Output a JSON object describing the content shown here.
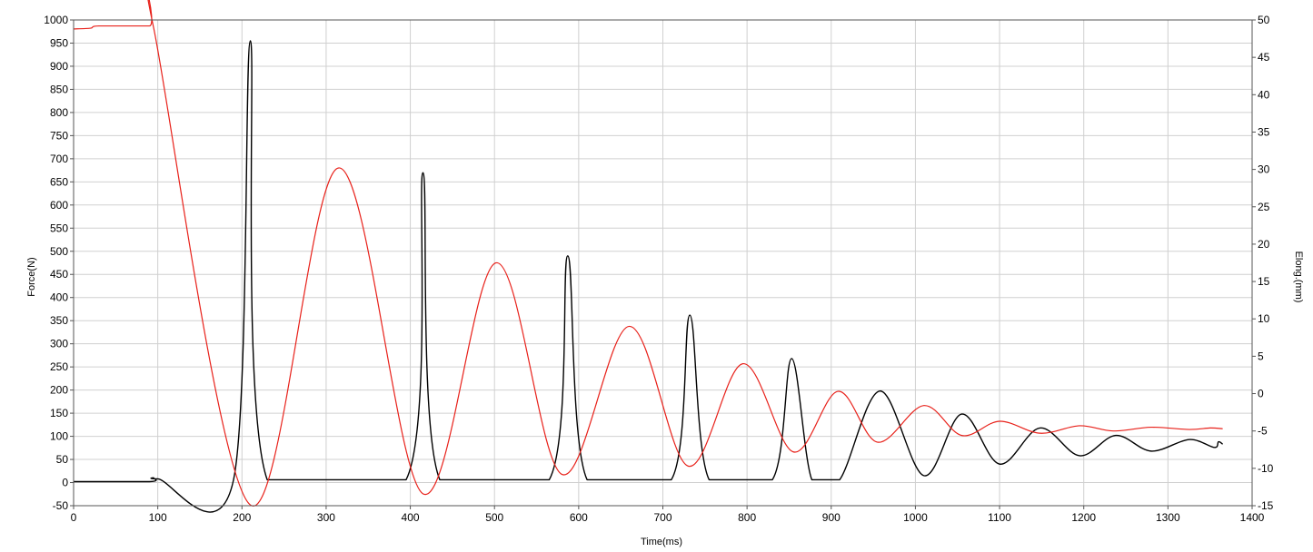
{
  "chart_data": {
    "type": "line",
    "title": "",
    "xlabel": "Time(ms)",
    "ylabel_left": "Force(N)",
    "ylabel_right": "Elong.(mm)",
    "xlim": [
      0,
      1400
    ],
    "ylim_left": [
      -50,
      1000
    ],
    "ylim_right": [
      -15,
      50
    ],
    "x_ticks": [
      0,
      100,
      200,
      300,
      400,
      500,
      600,
      700,
      800,
      900,
      1000,
      1100,
      1200,
      1300,
      1400
    ],
    "y_left_ticks": [
      -50,
      0,
      50,
      100,
      150,
      200,
      250,
      300,
      350,
      400,
      450,
      500,
      550,
      600,
      650,
      700,
      750,
      800,
      850,
      900,
      950,
      1000
    ],
    "y_right_ticks": [
      -15,
      -10,
      -5,
      0,
      5,
      10,
      15,
      20,
      25,
      30,
      35,
      40,
      45,
      50
    ],
    "grid": true,
    "series": [
      {
        "axis": "left",
        "color": "#000000",
        "points": [
          [
            0,
            2
          ],
          [
            90,
            2
          ],
          [
            95,
            10
          ],
          [
            100,
            8
          ],
          [
            190,
            6
          ],
          [
            210,
            955
          ],
          [
            230,
            6
          ],
          [
            395,
            6
          ],
          [
            415,
            670
          ],
          [
            435,
            6
          ],
          [
            565,
            6
          ],
          [
            587,
            490
          ],
          [
            610,
            6
          ],
          [
            710,
            6
          ],
          [
            732,
            362
          ],
          [
            755,
            6
          ],
          [
            830,
            6
          ],
          [
            853,
            268
          ],
          [
            877,
            6
          ],
          [
            910,
            6
          ],
          [
            958,
            198
          ],
          [
            1010,
            15
          ],
          [
            1055,
            148
          ],
          [
            1100,
            40
          ],
          [
            1148,
            118
          ],
          [
            1195,
            58
          ],
          [
            1238,
            102
          ],
          [
            1280,
            68
          ],
          [
            1325,
            93
          ],
          [
            1355,
            76
          ],
          [
            1360,
            88
          ],
          [
            1365,
            83
          ]
        ]
      },
      {
        "axis": "right",
        "color": "#e8211a",
        "points": [
          [
            0,
            48.8
          ],
          [
            20,
            48.9
          ],
          [
            30,
            49.2
          ],
          [
            90,
            49.2
          ],
          [
            95,
            49.0
          ],
          [
            210,
            -14.9
          ],
          [
            315,
            30.2
          ],
          [
            415,
            -13.4
          ],
          [
            502,
            17.5
          ],
          [
            580,
            -10.8
          ],
          [
            660,
            9.0
          ],
          [
            730,
            -9.7
          ],
          [
            795,
            4.0
          ],
          [
            855,
            -7.8
          ],
          [
            908,
            0.3
          ],
          [
            955,
            -6.5
          ],
          [
            1010,
            -1.6
          ],
          [
            1055,
            -5.6
          ],
          [
            1100,
            -3.7
          ],
          [
            1148,
            -5.3
          ],
          [
            1195,
            -4.3
          ],
          [
            1235,
            -5.0
          ],
          [
            1280,
            -4.5
          ],
          [
            1325,
            -4.8
          ],
          [
            1350,
            -4.6
          ],
          [
            1365,
            -4.7
          ]
        ]
      }
    ]
  }
}
